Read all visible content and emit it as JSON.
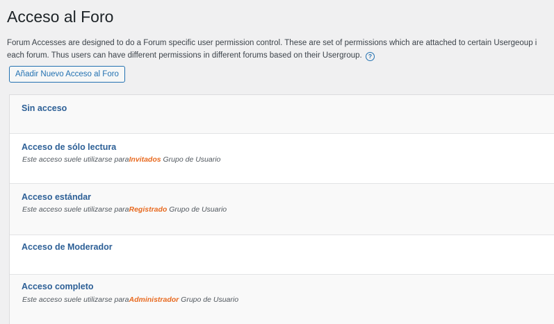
{
  "page": {
    "title": "Acceso al Foro",
    "description_line1": "Forum Accesses are designed to do a Forum specific user permission control. These are set of permissions which are attached to certain Usergeoup i",
    "description_line2": "each forum. Thus users can have different permissions in different forums based on their Usergroup.",
    "help_icon": "?",
    "add_button_label": "Añadir Nuevo Acceso al Foro"
  },
  "access_list": [
    {
      "title": "Sin acceso",
      "prefix": "",
      "group": "",
      "suffix": ""
    },
    {
      "title": "Acceso de sólo lectura",
      "prefix": "Este acceso suele utilizarse para",
      "group": "Invitados",
      "suffix": " Grupo de Usuario"
    },
    {
      "title": "Acceso estándar",
      "prefix": "Este acceso suele utilizarse para",
      "group": "Registrado",
      "suffix": " Grupo de Usuario"
    },
    {
      "title": "Acceso de Moderador",
      "prefix": "",
      "group": "",
      "suffix": ""
    },
    {
      "title": "Acceso completo",
      "prefix": "Este acceso suele utilizarse para",
      "group": "Administrador",
      "suffix": " Grupo de Usuario"
    }
  ],
  "colors": {
    "link": "#2c5f96",
    "group_highlight": "#e86a20",
    "button_border": "#2271b1",
    "background": "#f0f0f1"
  }
}
